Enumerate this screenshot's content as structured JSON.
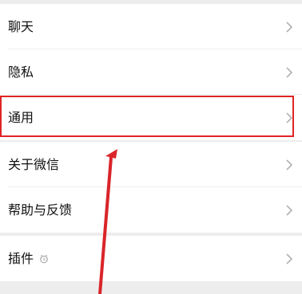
{
  "settings": {
    "group1": [
      {
        "label": "聊天"
      },
      {
        "label": "隐私"
      },
      {
        "label": "通用"
      }
    ],
    "group2": [
      {
        "label": "关于微信"
      },
      {
        "label": "帮助与反馈"
      }
    ],
    "group3": [
      {
        "label": "插件"
      }
    ]
  },
  "icons": {
    "row_chevron": "chevron-right-icon",
    "plugin_badge": "clock-icon"
  },
  "colors": {
    "highlight": "#e02424",
    "arrow": "#d9252a",
    "background": "#ededed",
    "row": "#ffffff"
  }
}
